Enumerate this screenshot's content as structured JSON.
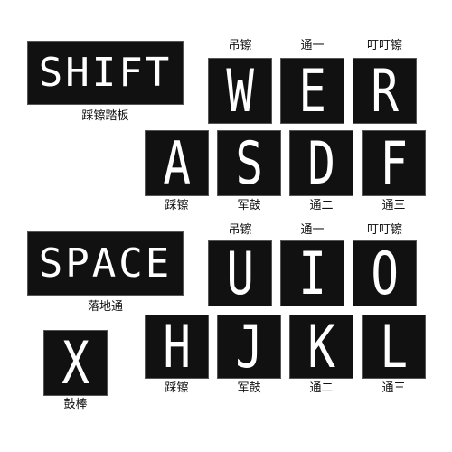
{
  "keys": {
    "shift": "SHIFT",
    "space": "SPACE",
    "x": "X",
    "w": "W",
    "e": "E",
    "r": "R",
    "a": "A",
    "s": "S",
    "d": "D",
    "f": "F",
    "u": "U",
    "i": "I",
    "o": "O",
    "h": "H",
    "j": "J",
    "k": "K",
    "l": "L"
  },
  "labels": {
    "shift": "踩镲踏板",
    "space": "落地通",
    "x": "鼓棒",
    "w": "吊镲",
    "e": "通一",
    "r": "叮叮镲",
    "a": "踩镲",
    "s": "军鼓",
    "d": "通二",
    "f": "通三",
    "u": "吊镲",
    "i": "通一",
    "o": "叮叮镲",
    "h": "踩镲",
    "j": "军鼓",
    "k": "通二",
    "l": "通三"
  }
}
